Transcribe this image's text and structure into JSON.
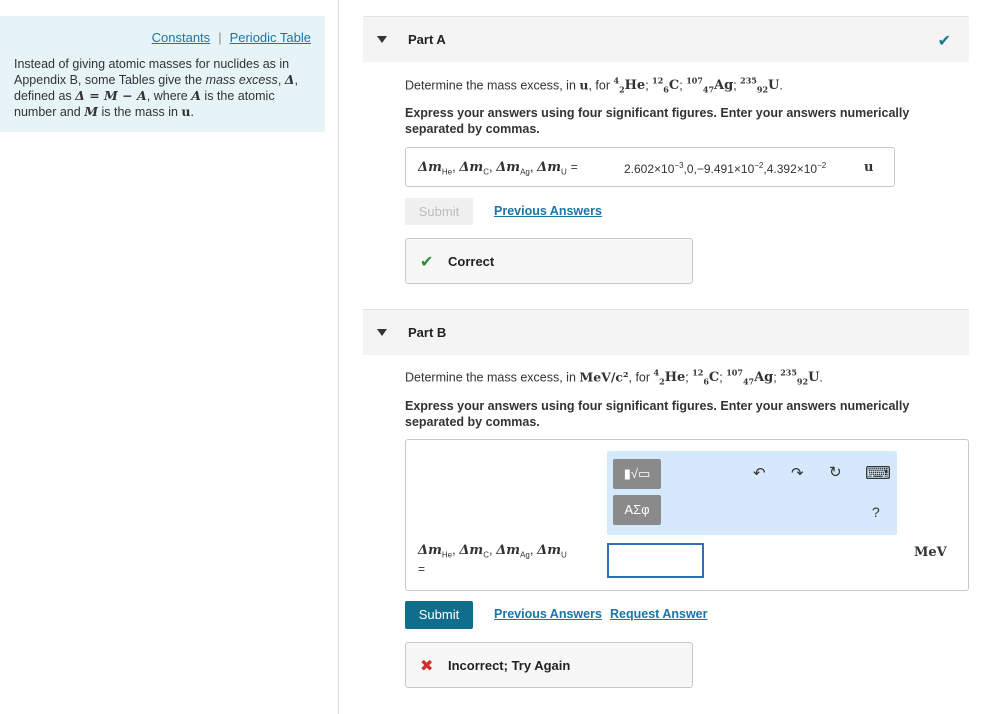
{
  "left_panel": {
    "links": {
      "constants": "Constants",
      "periodic_table": "Periodic Table",
      "separator": "|"
    },
    "intro": {
      "part1": "Instead of giving atomic masses for nuclides as in Appendix B, some Tables give the ",
      "em": "mass excess",
      "part2": ", ",
      "delta": "Δ",
      "part3": ", defined as ",
      "formula": "Δ = M − A",
      "part4": ", where ",
      "A": "A",
      "part5": " is the atomic number and ",
      "M": "M",
      "part6": " is the mass in ",
      "u": "u",
      "part7": "."
    }
  },
  "part_a": {
    "title": "Part A",
    "question_prefix": "Determine the mass excess, in ",
    "unit": "u",
    "question_mid": ", for ",
    "nuclides": [
      {
        "a": "4",
        "z": "2",
        "sym": "He"
      },
      {
        "a": "12",
        "z": "6",
        "sym": "C"
      },
      {
        "a": "107",
        "z": "47",
        "sym": "Ag"
      },
      {
        "a": "235",
        "z": "92",
        "sym": "U"
      }
    ],
    "instruction": "Express your answers using four significant figures. Enter your answers numerically separated by commas.",
    "vars": {
      "d": "Δ",
      "m": "m",
      "he": "He",
      "c": "C",
      "ag": "Ag",
      "u": "U",
      "eq": "="
    },
    "answer": {
      "v1": "2.602×10",
      "e1": "−3",
      "v2": ",0,−9.491×10",
      "e2": "−2",
      "v3": ",4.392×10",
      "e3": "−2"
    },
    "answer_unit": "u",
    "submit_label": "Submit",
    "previous_answers": "Previous Answers",
    "feedback": "Correct"
  },
  "part_b": {
    "title": "Part B",
    "question_prefix": "Determine the mass excess, in ",
    "unit": "MeV/c²",
    "question_mid": ", for ",
    "instruction": "Express your answers using four significant figures. Enter your answers numerically separated by commas.",
    "input_value": "",
    "answer_unit": "MeV",
    "toolbar": {
      "templates_label": "▮√▭",
      "greek_label": "ΑΣφ",
      "help": "?"
    },
    "submit_label": "Submit",
    "previous_answers": "Previous Answers",
    "request_answer": "Request Answer",
    "feedback": "Incorrect; Try Again"
  },
  "icons": {
    "check": "✔",
    "cross": "✖",
    "undo": "↶",
    "redo": "↷",
    "reset": "↻",
    "keyboard": "⌨"
  },
  "colors": {
    "accent": "#0f6e8c",
    "link": "#1b75a6",
    "correct": "#2e8b3a",
    "incorrect": "#d0312d"
  }
}
